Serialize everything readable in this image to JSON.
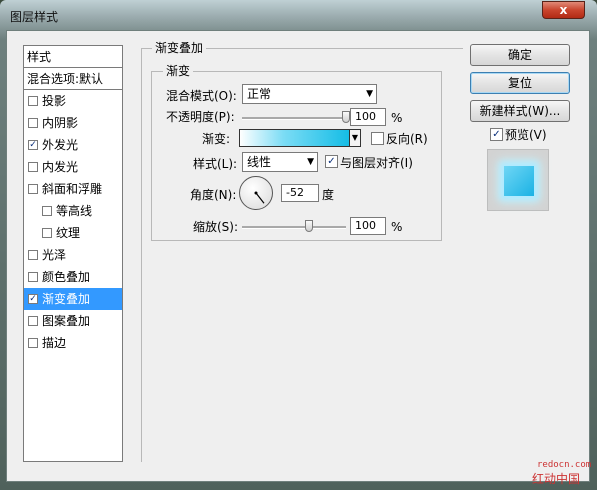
{
  "window": {
    "title": "图层样式",
    "close": "x"
  },
  "stylelist": {
    "header": "样式",
    "blend_default": "混合选项:默认",
    "items": [
      {
        "label": "投影",
        "checked": false
      },
      {
        "label": "内阴影",
        "checked": false
      },
      {
        "label": "外发光",
        "checked": true
      },
      {
        "label": "内发光",
        "checked": false
      },
      {
        "label": "斜面和浮雕",
        "checked": false
      },
      {
        "label": "等高线",
        "checked": false
      },
      {
        "label": "纹理",
        "checked": false
      },
      {
        "label": "光泽",
        "checked": false
      },
      {
        "label": "颜色叠加",
        "checked": false
      },
      {
        "label": "渐变叠加",
        "checked": true
      },
      {
        "label": "图案叠加",
        "checked": false
      },
      {
        "label": "描边",
        "checked": false
      }
    ]
  },
  "panel": {
    "group_title": "渐变叠加",
    "subgroup_title": "渐变",
    "blend_mode_label": "混合模式(O):",
    "blend_mode_value": "正常",
    "opacity_label": "不透明度(P):",
    "opacity_value": "100",
    "opacity_unit": "%",
    "gradient_label": "渐变:",
    "reverse_label": "反向(R)",
    "reverse_checked": false,
    "style_label": "样式(L):",
    "style_value": "线性",
    "align_label": "与图层对齐(I)",
    "align_checked": true,
    "angle_label": "角度(N):",
    "angle_value": "-52",
    "angle_unit": "度",
    "scale_label": "缩放(S):",
    "scale_value": "100",
    "scale_unit": "%",
    "check_mark": "✓",
    "dropdown_arrow": "▼"
  },
  "buttons": {
    "ok": "确定",
    "reset": "复位",
    "new_style": "新建样式(W)...",
    "preview_label": "预览(V)",
    "preview_checked": true
  },
  "watermark": {
    "url": "redocn.com",
    "name": "红动中国"
  }
}
